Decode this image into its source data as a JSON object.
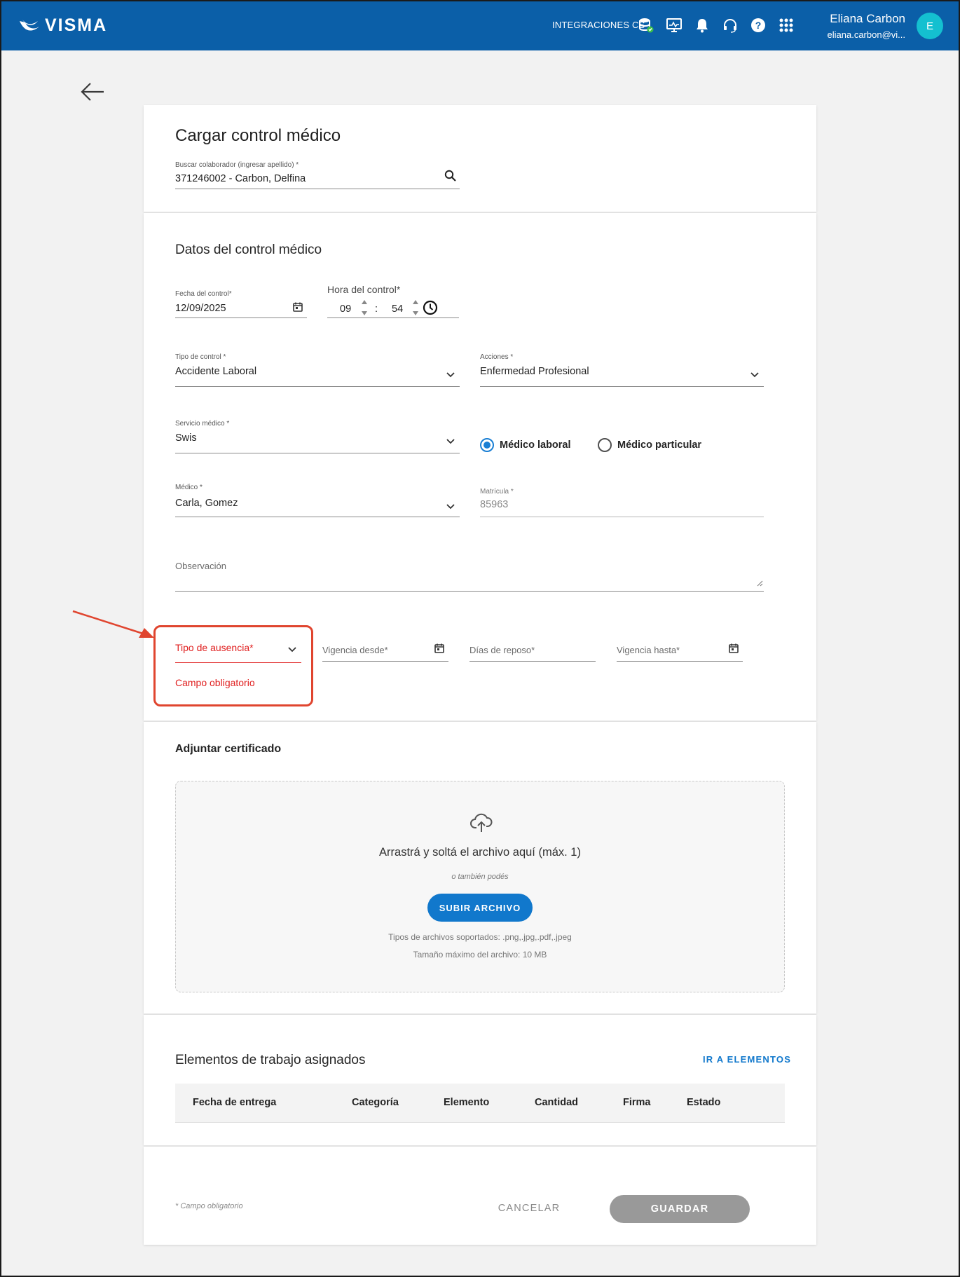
{
  "topbar": {
    "brand": "VISMA",
    "integrations_label": "INTEGRACIONES CS",
    "icons": [
      "database-check-icon",
      "monitor-activity-icon",
      "bell-icon",
      "headset-icon",
      "help-icon",
      "apps-grid-icon"
    ],
    "user_name": "Eliana Carbon",
    "user_email": "eliana.carbon@vi...",
    "avatar_initial": "E",
    "bg_color": "#0b5fa8",
    "avatar_color": "#14c0d0"
  },
  "page": {
    "title": "Cargar control médico",
    "search": {
      "label": "Buscar colaborador (ingresar apellido) *",
      "value": "371246002 - Carbon, Delfina"
    }
  },
  "control": {
    "section_title": "Datos del control médico",
    "fecha": {
      "label": "Fecha del control*",
      "value": "12/09/2025"
    },
    "hora": {
      "label": "Hora del control*",
      "hours": "09",
      "separator": ":",
      "minutes": "54"
    },
    "tipo_control": {
      "label": "Tipo de control *",
      "value": "Accidente Laboral"
    },
    "acciones": {
      "label": "Acciones *",
      "value": "Enfermedad Profesional"
    },
    "servicio": {
      "label": "Servicio médico *",
      "value": "Swis"
    },
    "radio_options": [
      {
        "label": "Médico laboral",
        "selected": true
      },
      {
        "label": "Médico particular",
        "selected": false
      }
    ],
    "medico": {
      "label": "Médico *",
      "value": "Carla, Gomez"
    },
    "matricula": {
      "label": "Matrícula *",
      "value": "85963"
    },
    "observacion": {
      "label": "Observación"
    },
    "tipo_ausencia": {
      "label": "Tipo de ausencia*",
      "error": "Campo obligatorio"
    },
    "vigencia_desde": {
      "label": "Vigencia desde*"
    },
    "dias_reposo": {
      "label": "Días de reposo*"
    },
    "vigencia_hasta": {
      "label": "Vigencia hasta*"
    },
    "error_color": "#e02020",
    "accent_color": "#1a7fd4"
  },
  "certificado": {
    "title": "Adjuntar certificado",
    "drop_text": "Arrastrá y soltá el archivo aquí (máx. 1)",
    "or_text": "o también podés",
    "upload_label": "SUBIR ARCHIVO",
    "types_text": "Tipos de archivos soportados: .png,.jpg,.pdf,.jpeg",
    "size_text": "Tamaño máximo del archivo: 10 MB"
  },
  "elementos": {
    "title": "Elementos de trabajo asignados",
    "link_label": "IR A ELEMENTOS",
    "columns": [
      "Fecha de entrega",
      "Categoría",
      "Elemento",
      "Cantidad",
      "Firma",
      "Estado"
    ]
  },
  "footer": {
    "note": "* Campo obligatorio",
    "cancel_label": "CANCELAR",
    "save_label": "GUARDAR"
  }
}
